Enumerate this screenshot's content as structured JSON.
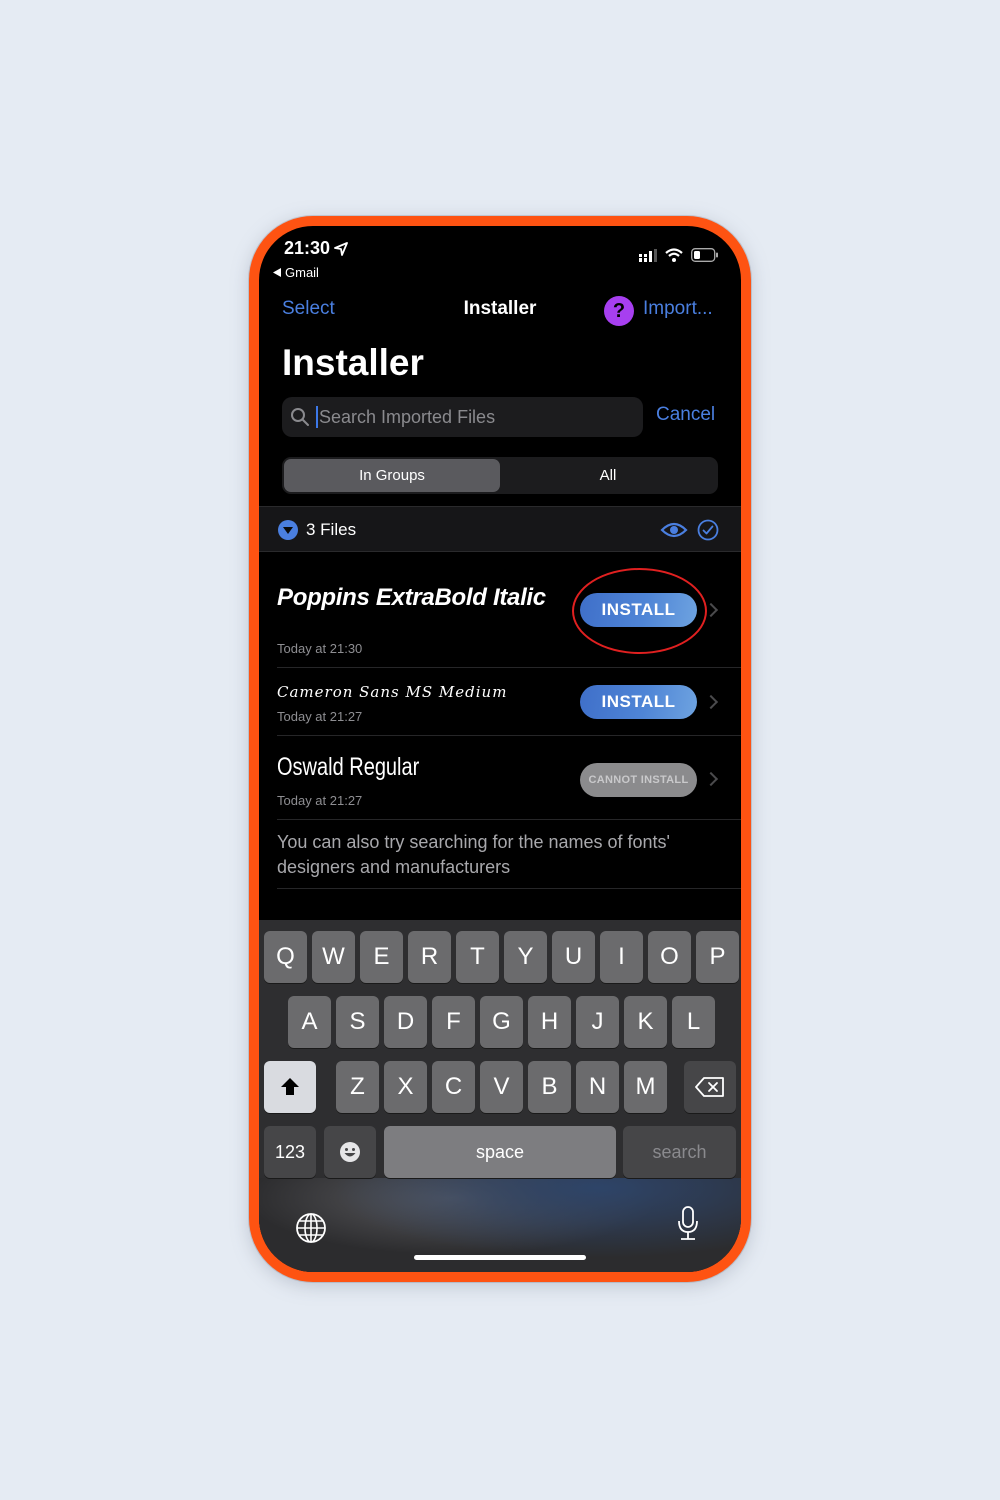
{
  "status_bar": {
    "time": "21:30",
    "back_app": "Gmail",
    "icons": [
      "location-arrow-icon",
      "signal-icon",
      "wifi-icon",
      "battery-icon"
    ]
  },
  "nav": {
    "select_label": "Select",
    "title": "Installer",
    "help_icon": "?",
    "import_label": "Import..."
  },
  "page_title": "Installer",
  "search": {
    "placeholder": "Search Imported Files",
    "value": "",
    "cancel_label": "Cancel"
  },
  "segments": {
    "items": [
      {
        "label": "In Groups",
        "active": true
      },
      {
        "label": "All",
        "active": false
      }
    ]
  },
  "section": {
    "count_label": "3 Files"
  },
  "files": [
    {
      "name": "Poppins ExtraBold Italic",
      "date": "Today at 21:30",
      "action": "INSTALL",
      "installable": true,
      "highlighted": true
    },
    {
      "name": "Cameron Sans MS Medium",
      "date": "Today at 21:27",
      "action": "INSTALL",
      "installable": true,
      "highlighted": false
    },
    {
      "name": "Oswald Regular",
      "date": "Today at 21:27",
      "action": "CANNOT INSTALL",
      "installable": false,
      "highlighted": false
    }
  ],
  "hint": "You can also try searching for the names of fonts' designers and manufacturers",
  "keyboard": {
    "row1": [
      "Q",
      "W",
      "E",
      "R",
      "T",
      "Y",
      "U",
      "I",
      "O",
      "P"
    ],
    "row2": [
      "A",
      "S",
      "D",
      "F",
      "G",
      "H",
      "J",
      "K",
      "L"
    ],
    "row3": [
      "Z",
      "X",
      "C",
      "V",
      "B",
      "N",
      "M"
    ],
    "numbers_label": "123",
    "space_label": "space",
    "search_label": "search"
  },
  "colors": {
    "frame": "#fe5312",
    "accent": "#4a7fe0",
    "help": "#a73ff0",
    "highlight_ring": "#e02020"
  }
}
